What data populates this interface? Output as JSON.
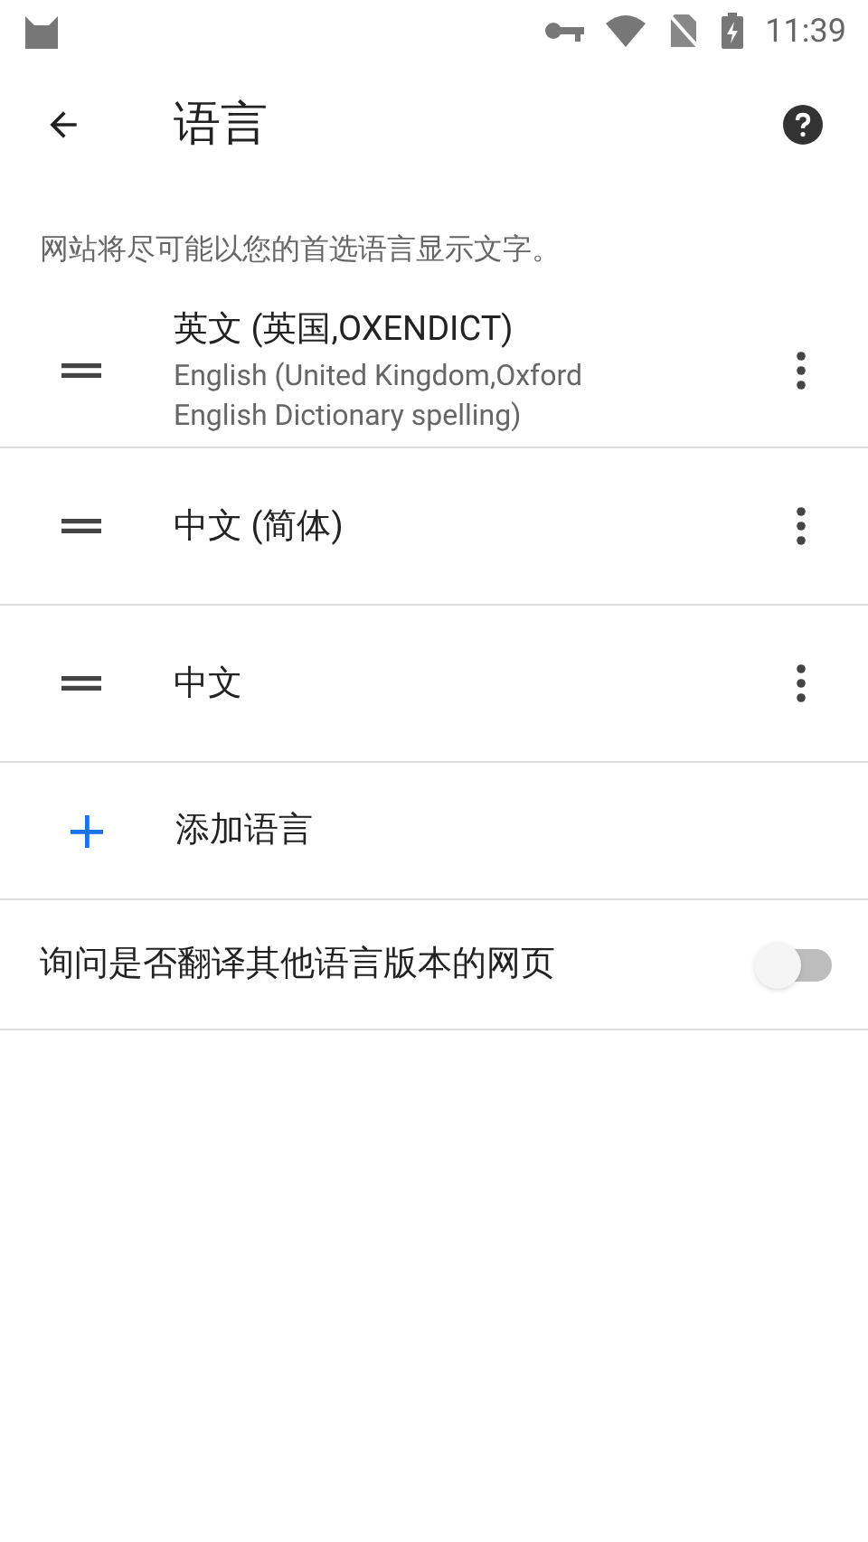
{
  "status_bar": {
    "time": "11:39"
  },
  "toolbar": {
    "title": "语言"
  },
  "description": "网站将尽可能以您的首选语言显示文字。",
  "languages": [
    {
      "name": "英文 (英国,OXENDICT)",
      "subtitle": "English (United Kingdom,Oxford English Dictionary spelling)"
    },
    {
      "name": "中文 (简体)"
    },
    {
      "name": "中文"
    }
  ],
  "add_language": {
    "label": "添加语言"
  },
  "translate_toggle": {
    "label": "询问是否翻译其他语言版本的网页",
    "on": false
  }
}
